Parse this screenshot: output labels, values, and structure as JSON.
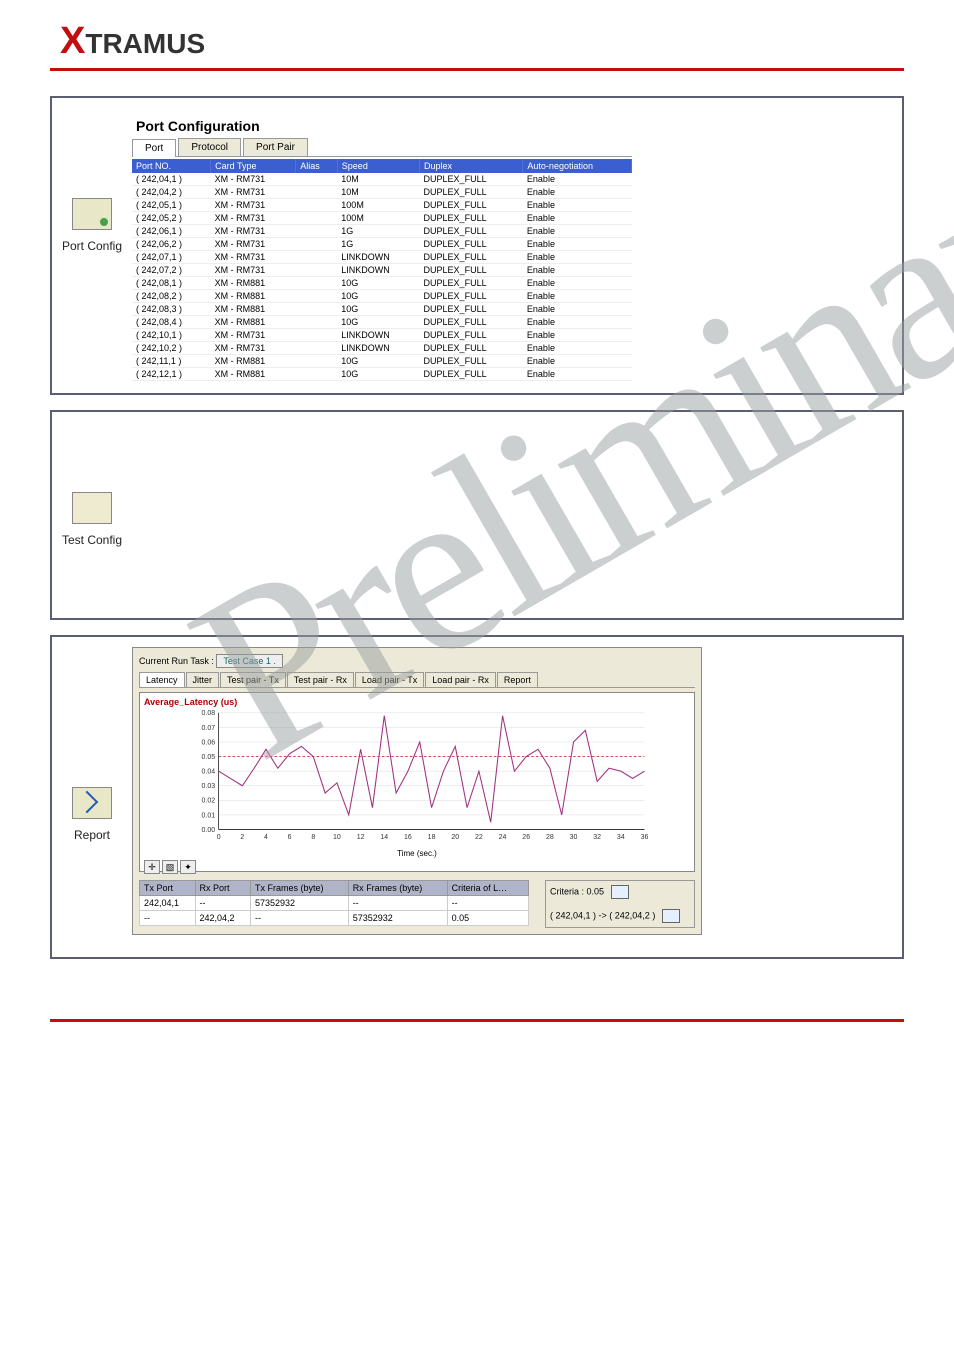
{
  "brand": "XTRAMUS",
  "sections": {
    "port_config": {
      "icon_label": "Port Config",
      "title": "Port Configuration",
      "tabs": [
        "Port",
        "Protocol",
        "Port Pair"
      ],
      "headers": [
        "Port NO.",
        "Card Type",
        "Alias",
        "Speed",
        "Duplex",
        "Auto-negotiation"
      ],
      "rows": [
        {
          "port": "( 242,04,1 )",
          "card": "XM - RM731",
          "alias": "",
          "speed": "10M",
          "duplex": "DUPLEX_FULL",
          "auto": "Enable"
        },
        {
          "port": "( 242,04,2 )",
          "card": "XM - RM731",
          "alias": "",
          "speed": "10M",
          "duplex": "DUPLEX_FULL",
          "auto": "Enable"
        },
        {
          "port": "( 242,05,1 )",
          "card": "XM - RM731",
          "alias": "",
          "speed": "100M",
          "duplex": "DUPLEX_FULL",
          "auto": "Enable"
        },
        {
          "port": "( 242,05,2 )",
          "card": "XM - RM731",
          "alias": "",
          "speed": "100M",
          "duplex": "DUPLEX_FULL",
          "auto": "Enable"
        },
        {
          "port": "( 242,06,1 )",
          "card": "XM - RM731",
          "alias": "",
          "speed": "1G",
          "duplex": "DUPLEX_FULL",
          "auto": "Enable"
        },
        {
          "port": "( 242,06,2 )",
          "card": "XM - RM731",
          "alias": "",
          "speed": "1G",
          "duplex": "DUPLEX_FULL",
          "auto": "Enable"
        },
        {
          "port": "( 242,07,1 )",
          "card": "XM - RM731",
          "alias": "",
          "speed": "LINKDOWN",
          "duplex": "DUPLEX_FULL",
          "auto": "Enable"
        },
        {
          "port": "( 242,07,2 )",
          "card": "XM - RM731",
          "alias": "",
          "speed": "LINKDOWN",
          "duplex": "DUPLEX_FULL",
          "auto": "Enable"
        },
        {
          "port": "( 242,08,1 )",
          "card": "XM - RM881",
          "alias": "",
          "speed": "10G",
          "duplex": "DUPLEX_FULL",
          "auto": "Enable"
        },
        {
          "port": "( 242,08,2 )",
          "card": "XM - RM881",
          "alias": "",
          "speed": "10G",
          "duplex": "DUPLEX_FULL",
          "auto": "Enable"
        },
        {
          "port": "( 242,08,3 )",
          "card": "XM - RM881",
          "alias": "",
          "speed": "10G",
          "duplex": "DUPLEX_FULL",
          "auto": "Enable"
        },
        {
          "port": "( 242,08,4 )",
          "card": "XM - RM881",
          "alias": "",
          "speed": "10G",
          "duplex": "DUPLEX_FULL",
          "auto": "Enable"
        },
        {
          "port": "( 242,10,1 )",
          "card": "XM - RM731",
          "alias": "",
          "speed": "LINKDOWN",
          "duplex": "DUPLEX_FULL",
          "auto": "Enable"
        },
        {
          "port": "( 242,10,2 )",
          "card": "XM - RM731",
          "alias": "",
          "speed": "LINKDOWN",
          "duplex": "DUPLEX_FULL",
          "auto": "Enable"
        },
        {
          "port": "( 242,11,1 )",
          "card": "XM - RM881",
          "alias": "",
          "speed": "10G",
          "duplex": "DUPLEX_FULL",
          "auto": "Enable"
        },
        {
          "port": "( 242,12,1 )",
          "card": "XM - RM881",
          "alias": "",
          "speed": "10G",
          "duplex": "DUPLEX_FULL",
          "auto": "Enable"
        }
      ]
    },
    "test_config": {
      "icon_label": "Test Config"
    },
    "report": {
      "icon_label": "Report",
      "current_run_label": "Current Run Task :",
      "current_task": "Test Case 1 .",
      "subtabs": [
        "Latency",
        "Jitter",
        "Test pair - Tx",
        "Test pair - Rx",
        "Load pair - Tx",
        "Load pair - Rx",
        "Report"
      ],
      "chart_label": "Average_Latency (us)",
      "xaxis_label": "Time (sec.)",
      "toolbar_plus": "✛",
      "pair_headers": [
        "Tx Port",
        "Rx Port",
        "Tx Frames (byte)",
        "Rx Frames (byte)",
        "Criteria of L…"
      ],
      "pair_rows": [
        {
          "tx": "242,04,1",
          "rx": "--",
          "txf": "57352932",
          "rxf": "--",
          "cr": "--"
        },
        {
          "tx": "--",
          "rx": "242,04,2",
          "txf": "--",
          "rxf": "57352932",
          "cr": "0.05"
        }
      ],
      "criteria_label": "Criteria : 0.05",
      "pair_desc": "( 242,04,1 ) -> ( 242,04,2 )"
    }
  },
  "watermark": "Preliminary",
  "chart_data": {
    "type": "line",
    "title": "Average_Latency (us)",
    "xlabel": "Time (sec.)",
    "ylabel": "",
    "xlim": [
      0,
      36
    ],
    "ylim": [
      0,
      0.08
    ],
    "xticks": [
      0,
      2,
      4,
      6,
      8,
      10,
      12,
      14,
      16,
      18,
      20,
      22,
      24,
      26,
      28,
      30,
      32,
      34,
      36
    ],
    "yticks": [
      0,
      0.01,
      0.02,
      0.03,
      0.04,
      0.05,
      0.06,
      0.07,
      0.08
    ],
    "threshold": 0.05,
    "series": [
      {
        "name": "Average_Latency",
        "x": [
          0,
          1,
          2,
          3,
          4,
          5,
          6,
          7,
          8,
          9,
          10,
          11,
          12,
          13,
          14,
          15,
          16,
          17,
          18,
          19,
          20,
          21,
          22,
          23,
          24,
          25,
          26,
          27,
          28,
          29,
          30,
          31,
          32,
          33,
          34,
          35,
          36
        ],
        "values": [
          0.04,
          0.035,
          0.03,
          0.042,
          0.055,
          0.042,
          0.052,
          0.057,
          0.05,
          0.025,
          0.032,
          0.01,
          0.055,
          0.015,
          0.078,
          0.025,
          0.04,
          0.06,
          0.015,
          0.04,
          0.057,
          0.015,
          0.04,
          0.005,
          0.078,
          0.04,
          0.05,
          0.055,
          0.042,
          0.01,
          0.06,
          0.068,
          0.033,
          0.042,
          0.04,
          0.035,
          0.04
        ]
      }
    ]
  }
}
